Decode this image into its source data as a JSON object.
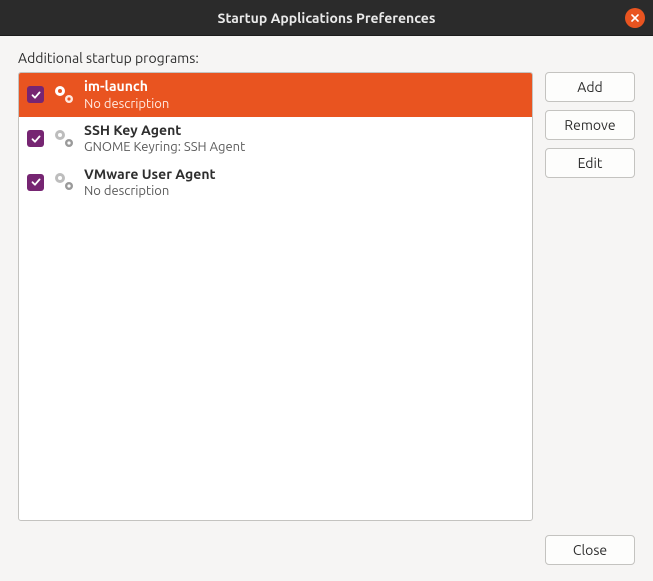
{
  "titlebar": {
    "title": "Startup Applications Preferences"
  },
  "section_label": "Additional startup programs:",
  "programs": [
    {
      "name": "im-launch",
      "description": "No description",
      "checked": true,
      "selected": true
    },
    {
      "name": "SSH Key Agent",
      "description": "GNOME Keyring: SSH Agent",
      "checked": true,
      "selected": false
    },
    {
      "name": "VMware User Agent",
      "description": "No description",
      "checked": true,
      "selected": false
    }
  ],
  "buttons": {
    "add": "Add",
    "remove": "Remove",
    "edit": "Edit",
    "close": "Close"
  }
}
